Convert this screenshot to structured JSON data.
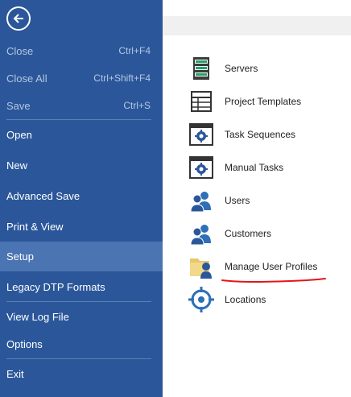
{
  "menu": {
    "items": [
      {
        "label": "Close",
        "shortcut": "Ctrl+F4",
        "state": "disabled"
      },
      {
        "label": "Close All",
        "shortcut": "Ctrl+Shift+F4",
        "state": "disabled"
      },
      {
        "label": "Save",
        "shortcut": "Ctrl+S",
        "state": "disabled"
      },
      {
        "label": "Open",
        "shortcut": "",
        "state": "normal"
      },
      {
        "label": "New",
        "shortcut": "",
        "state": "normal"
      },
      {
        "label": "Advanced Save",
        "shortcut": "",
        "state": "normal"
      },
      {
        "label": "Print & View",
        "shortcut": "",
        "state": "normal"
      },
      {
        "label": "Setup",
        "shortcut": "",
        "state": "selected"
      },
      {
        "label": "Legacy DTP Formats",
        "shortcut": "",
        "state": "normal"
      },
      {
        "label": "View Log File",
        "shortcut": "",
        "state": "normal"
      },
      {
        "label": "Options",
        "shortcut": "",
        "state": "normal"
      },
      {
        "label": "Exit",
        "shortcut": "",
        "state": "normal"
      }
    ]
  },
  "setup": {
    "items": [
      {
        "label": "Servers",
        "icon": "server-icon"
      },
      {
        "label": "Project Templates",
        "icon": "project-template-icon"
      },
      {
        "label": "Task Sequences",
        "icon": "task-sequence-icon"
      },
      {
        "label": "Manual Tasks",
        "icon": "manual-task-icon"
      },
      {
        "label": "Users",
        "icon": "users-icon"
      },
      {
        "label": "Customers",
        "icon": "customers-icon"
      },
      {
        "label": "Manage User Profiles",
        "icon": "user-profile-folder-icon"
      },
      {
        "label": "Locations",
        "icon": "location-target-icon"
      }
    ]
  },
  "colors": {
    "sidebar": "#2b579a",
    "selected": "#4b74b3",
    "disabled_text": "#b4c6e0",
    "annotation": "#e8131b"
  }
}
